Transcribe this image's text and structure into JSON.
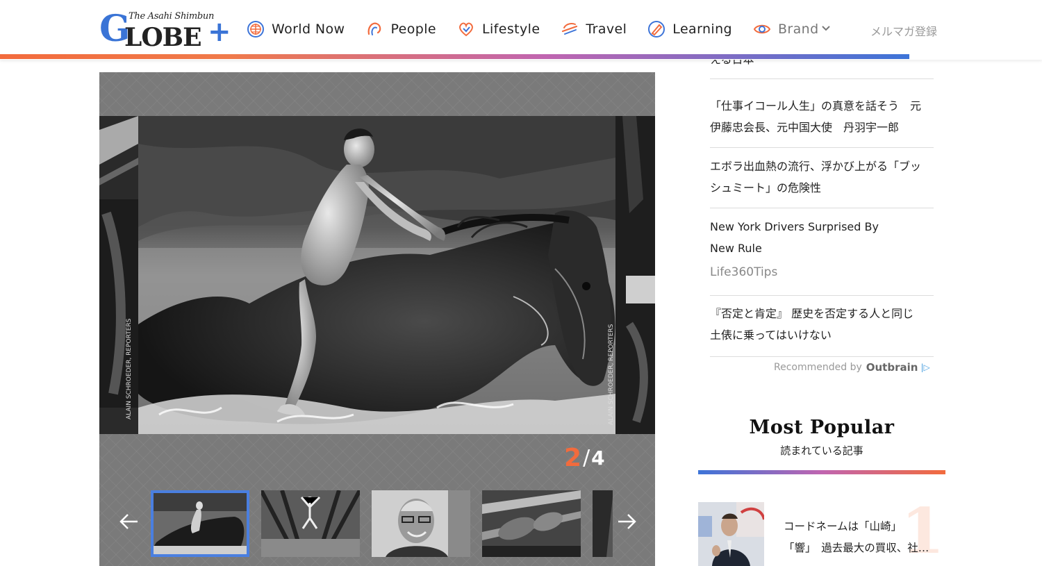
{
  "header": {
    "logo": {
      "tagline": "The Asahi Shimbun",
      "wordmark_g": "G",
      "wordmark_rest": "LOBE",
      "wordmark_plus": "+"
    },
    "nav": [
      {
        "label": "World Now",
        "icon": "globe-icon"
      },
      {
        "label": "People",
        "icon": "people-icon"
      },
      {
        "label": "Lifestyle",
        "icon": "heart-icon"
      },
      {
        "label": "Travel",
        "icon": "travel-icon"
      },
      {
        "label": "Learning",
        "icon": "pencil-icon"
      },
      {
        "label": "Brand",
        "icon": "eye-icon"
      }
    ],
    "newsletter_label": "メルマガ登録",
    "colors": {
      "accent_orange": "#f26b3d",
      "accent_blue": "#3d74d8",
      "accent_purple": "#c065b0"
    }
  },
  "gallery": {
    "current": "2",
    "separator": "/",
    "total": "4",
    "credit_left": "ALAIN SCHROEDER, REPORTERS",
    "credit_right": "ALAIN SCHROEDER, REPORTERS",
    "thumbnails": [
      "boy-on-horse",
      "jumping-dancer",
      "smiling-man",
      "hands-on-rope",
      "partial-next"
    ],
    "active_thumbnail": 1
  },
  "sidebar": {
    "cut_off_text": "える日本",
    "recommended": [
      {
        "lines": [
          "「仕事イコール人生」の真意を話そう　元",
          "伊藤忠会長、元中国大使　丹羽宇一郎"
        ]
      },
      {
        "lines": [
          "エボラ出血熱の流行、浮かび上がる「ブッ",
          "シュミート」の危険性"
        ]
      },
      {
        "lines": [
          "New York Drivers Surprised By",
          "New Rule"
        ],
        "source": "Life360Tips"
      },
      {
        "lines": [
          "『否定と肯定』 歴史を否定する人と同じ",
          "土俵に乗ってはいけない"
        ]
      }
    ],
    "outbrain": {
      "prefix": "Recommended by",
      "brand": "Outbrain",
      "badge": "|▷"
    },
    "popular": {
      "title": "Most Popular",
      "subtitle": "読まれている記事",
      "items": [
        {
          "rank": "1",
          "lines": [
            "コードネームは「山崎」",
            "「響」　過去最大の買収、社…"
          ]
        }
      ]
    }
  }
}
